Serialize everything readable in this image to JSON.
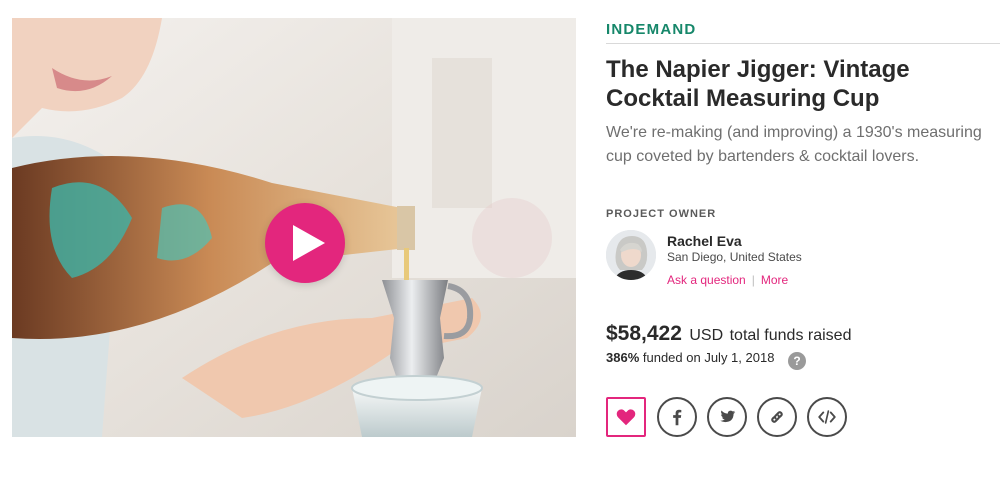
{
  "media": {
    "play_icon": "play-icon",
    "accent_color": "#e3267d"
  },
  "campaign": {
    "category": "INDEMAND",
    "title": "The Napier Jigger: Vintage Cocktail Measuring Cup",
    "blurb": "We're re-making (and improving) a 1930's measuring cup coveted by bartenders & cocktail lovers."
  },
  "owner": {
    "label": "PROJECT OWNER",
    "name": "Rachel Eva",
    "location": "San Diego, United States",
    "ask_link": "Ask a question",
    "separator": "|",
    "more_link": "More"
  },
  "funding": {
    "amount": "$58,422",
    "currency": "USD",
    "amount_text": "total funds raised",
    "percent": "386%",
    "funded_text": "funded on July 1, 2018",
    "help_icon": "?"
  },
  "actions": [
    {
      "icon": "heart-icon"
    },
    {
      "icon": "facebook-icon"
    },
    {
      "icon": "twitter-icon"
    },
    {
      "icon": "link-icon"
    },
    {
      "icon": "embed-code-icon"
    }
  ],
  "colors": {
    "category_green": "#16876a",
    "accent_pink": "#e3267d",
    "text_dark": "#2a2a2a",
    "text_muted": "#6f6f6f"
  }
}
